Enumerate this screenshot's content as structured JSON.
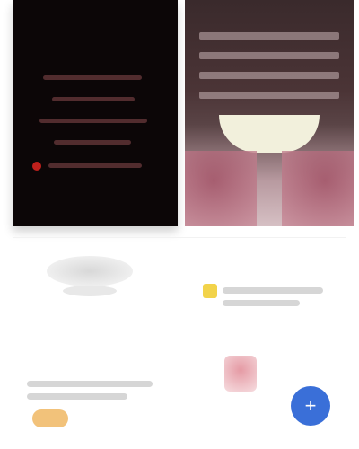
{
  "tiles": {
    "left": {
      "icon": "dark-image"
    },
    "right": {
      "icon": "pink-bowl-image"
    }
  },
  "lower": {
    "small_label": "",
    "fab_symbol": "+"
  },
  "colors": {
    "yellow": "#f2d34a",
    "orange": "#f2c27a",
    "blue": "#3a6fd8",
    "pink": "#e59aa4"
  }
}
